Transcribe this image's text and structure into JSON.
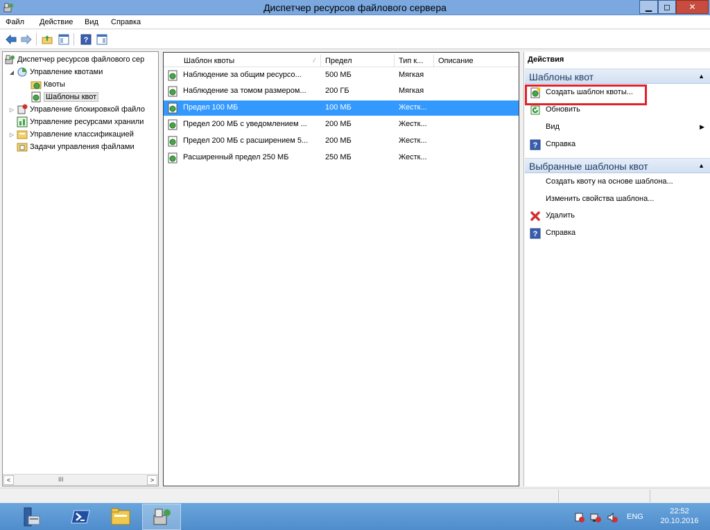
{
  "window": {
    "title": "Диспетчер ресурсов файлового сервера",
    "minimize": "▁",
    "maximize": "◻",
    "close": "✕"
  },
  "menubar": {
    "items": [
      "Файл",
      "Действие",
      "Вид",
      "Справка"
    ]
  },
  "tree": {
    "items": [
      {
        "label": "Диспетчер ресурсов файлового сер",
        "icon": "fsrm-icon"
      },
      {
        "label": "Управление квотами",
        "icon": "quota-management-icon",
        "expander": "◢"
      },
      {
        "label": "Квоты",
        "icon": "quotas-folder-icon"
      },
      {
        "label": "Шаблоны квот",
        "icon": "quota-templates-icon"
      },
      {
        "label": "Управление блокировкой файло",
        "icon": "file-screen-icon",
        "expander": "▷"
      },
      {
        "label": "Управление ресурсами хранили",
        "icon": "storage-reports-icon"
      },
      {
        "label": "Управление классификацией",
        "icon": "classification-icon",
        "expander": "▷"
      },
      {
        "label": "Задачи управления файлами",
        "icon": "file-tasks-icon"
      }
    ],
    "scroll_grip": "III"
  },
  "list": {
    "columns": [
      "Шаблон квоты",
      "Предел",
      "Тип к...",
      "Описание"
    ],
    "sort_indicator": "⁄",
    "rows": [
      {
        "name": "Наблюдение за общим ресурсо...",
        "limit": "500 МБ",
        "type": "Мягкая",
        "description": ""
      },
      {
        "name": "Наблюдение за томом размером...",
        "limit": "200 ГБ",
        "type": "Мягкая",
        "description": ""
      },
      {
        "name": "Предел 100 МБ",
        "limit": "100 МБ",
        "type": "Жестк...",
        "description": ""
      },
      {
        "name": "Предел 200 МБ с уведомлением ...",
        "limit": "200 МБ",
        "type": "Жестк...",
        "description": ""
      },
      {
        "name": "Предел 200 МБ с расширением 5...",
        "limit": "200 МБ",
        "type": "Жестк...",
        "description": ""
      },
      {
        "name": "Расширенный предел 250 МБ",
        "limit": "250 МБ",
        "type": "Жестк...",
        "description": ""
      }
    ],
    "selected_index": 2
  },
  "actions": {
    "title": "Действия",
    "section1": {
      "title": "Шаблоны квот",
      "items": [
        {
          "label": "Создать шаблон квоты...",
          "icon": "create-template-icon"
        },
        {
          "label": "Обновить",
          "icon": "refresh-icon"
        },
        {
          "label": "Вид",
          "icon": ""
        },
        {
          "label": "Справка",
          "icon": "help-icon"
        }
      ]
    },
    "section2": {
      "title": "Выбранные шаблоны квот",
      "items": [
        {
          "label": "Создать квоту на основе шаблона...",
          "icon": ""
        },
        {
          "label": "Изменить свойства шаблона...",
          "icon": ""
        },
        {
          "label": "Удалить",
          "icon": "delete-icon"
        },
        {
          "label": "Справка",
          "icon": "help-icon"
        }
      ]
    },
    "collapse_glyph": "▲",
    "submenu_glyph": "▶"
  },
  "taskbar": {
    "language": "ENG",
    "time": "22:52",
    "date": "20.10.2016"
  },
  "colors": {
    "selection": "#3399ff",
    "highlight_box": "#e0202a",
    "taskbar": "#5b9bd5"
  }
}
